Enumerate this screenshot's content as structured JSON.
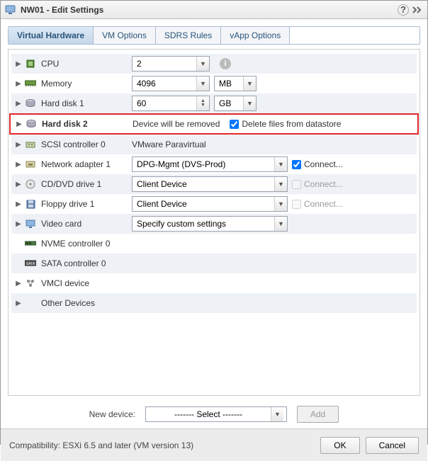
{
  "title": "NW01 - Edit Settings",
  "tabs": [
    {
      "label": "Virtual Hardware"
    },
    {
      "label": "VM Options"
    },
    {
      "label": "SDRS Rules"
    },
    {
      "label": "vApp Options"
    }
  ],
  "rows": {
    "cpu": {
      "label": "CPU",
      "value": "2"
    },
    "memory": {
      "label": "Memory",
      "value": "4096",
      "unit": "MB"
    },
    "hd1": {
      "label": "Hard disk 1",
      "value": "60",
      "unit": "GB"
    },
    "hd2": {
      "label": "Hard disk 2",
      "msg": "Device will be removed",
      "chk": "Delete files from datastore"
    },
    "scsi": {
      "label": "SCSI controller 0",
      "value": "VMware Paravirtual"
    },
    "net": {
      "label": "Network adapter 1",
      "value": "DPG-Mgmt (DVS-Prod)",
      "chk": "Connect..."
    },
    "cd": {
      "label": "CD/DVD drive 1",
      "value": "Client Device",
      "chk": "Connect..."
    },
    "floppy": {
      "label": "Floppy drive 1",
      "value": "Client Device",
      "chk": "Connect..."
    },
    "video": {
      "label": "Video card",
      "value": "Specify custom settings"
    },
    "nvme": {
      "label": "NVME controller 0"
    },
    "sata": {
      "label": "SATA controller 0"
    },
    "vmci": {
      "label": "VMCI device"
    },
    "other": {
      "label": "Other Devices"
    }
  },
  "newdev": {
    "label": "New device:",
    "value": "------- Select -------",
    "add": "Add"
  },
  "footer": {
    "compat": "Compatibility: ESXi 6.5 and later (VM version 13)",
    "ok": "OK",
    "cancel": "Cancel"
  }
}
